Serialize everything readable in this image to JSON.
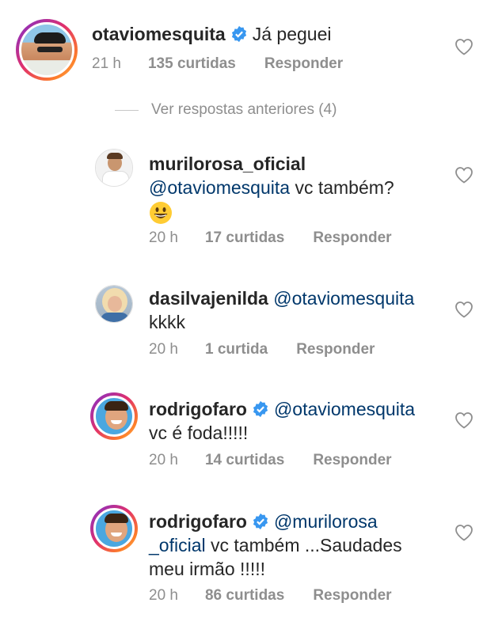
{
  "comments": [
    {
      "username": "otaviomesquita",
      "verified": true,
      "mention": "",
      "text": "Já peguei",
      "time": "21 h",
      "likes": "135 curtidas",
      "reply": "Responder"
    },
    {
      "username": "murilorosa_oficial",
      "verified": false,
      "mention": "@otaviomesquita",
      "text": "vc também?",
      "emoji": "😃",
      "time": "20 h",
      "likes": "17 curtidas",
      "reply": "Responder"
    },
    {
      "username": "dasilvajenilda",
      "verified": false,
      "mention": "@otaviomesquita",
      "text": "kkkk",
      "time": "20 h",
      "likes": "1 curtida",
      "reply": "Responder"
    },
    {
      "username": "rodrigofaro",
      "verified": true,
      "mention": "@otaviomesquita",
      "text": "vc é foda!!!!!",
      "time": "20 h",
      "likes": "14 curtidas",
      "reply": "Responder"
    },
    {
      "username": "rodrigofaro",
      "verified": true,
      "mention_part1": "@murilorosa",
      "mention_part2": "_oficial",
      "text_line1": "vc também ...Saudades",
      "text_line2": "meu irmão !!!!!",
      "time": "20 h",
      "likes": "86 curtidas",
      "reply": "Responder"
    }
  ],
  "view_previous_replies": "Ver respostas anteriores (4)",
  "colors": {
    "mention": "#00376b",
    "meta": "#8e8e8e",
    "verified": "#3897f0"
  },
  "icons": [
    "heart-outline-icon",
    "verified-badge-icon"
  ]
}
